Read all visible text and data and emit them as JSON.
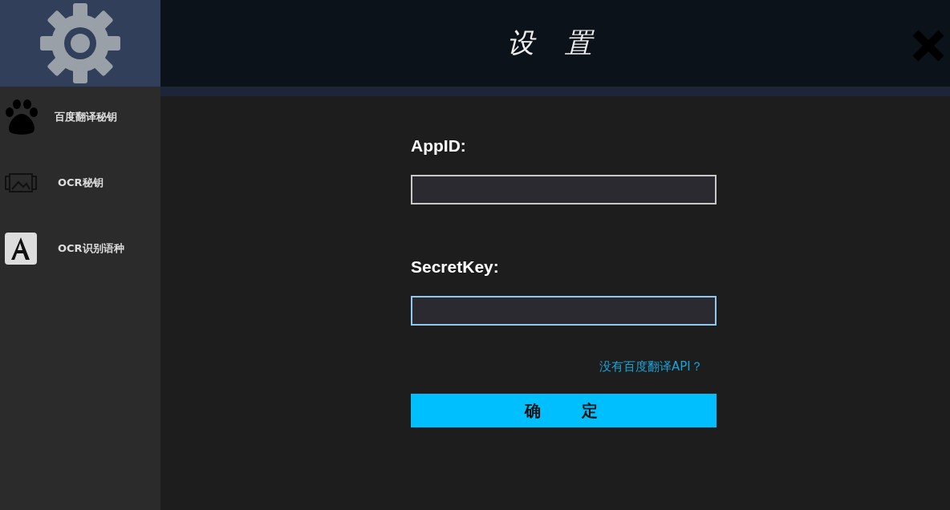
{
  "window": {
    "title": "设 置"
  },
  "sidebar": {
    "items": [
      {
        "label": "百度翻译秘钥",
        "kind": "paw"
      },
      {
        "label": "OCR秘钥",
        "kind": "image"
      },
      {
        "label": "OCR识别语种",
        "kind": "letter"
      }
    ]
  },
  "form": {
    "fields": [
      {
        "label": "AppID:",
        "focused": false
      },
      {
        "label": "SecretKey:",
        "focused": true
      }
    ],
    "link": "没有百度翻译API？",
    "submit": "确 定"
  }
}
